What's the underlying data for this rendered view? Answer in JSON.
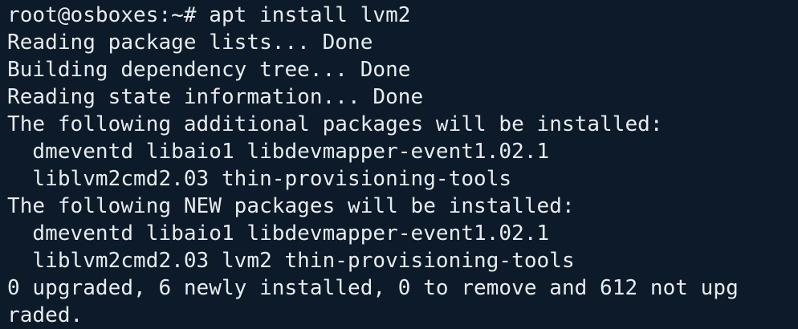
{
  "terminal": {
    "lines": [
      "root@osboxes:~# apt install lvm2",
      "Reading package lists... Done",
      "Building dependency tree... Done",
      "Reading state information... Done",
      "The following additional packages will be installed:",
      "  dmeventd libaio1 libdevmapper-event1.02.1",
      "  liblvm2cmd2.03 thin-provisioning-tools",
      "The following NEW packages will be installed:",
      "  dmeventd libaio1 libdevmapper-event1.02.1",
      "  liblvm2cmd2.03 lvm2 thin-provisioning-tools",
      "0 upgraded, 6 newly installed, 0 to remove and 612 not upg",
      "raded."
    ],
    "colors": {
      "background": "#0c1a2a",
      "foreground": "#e8ecef"
    }
  }
}
